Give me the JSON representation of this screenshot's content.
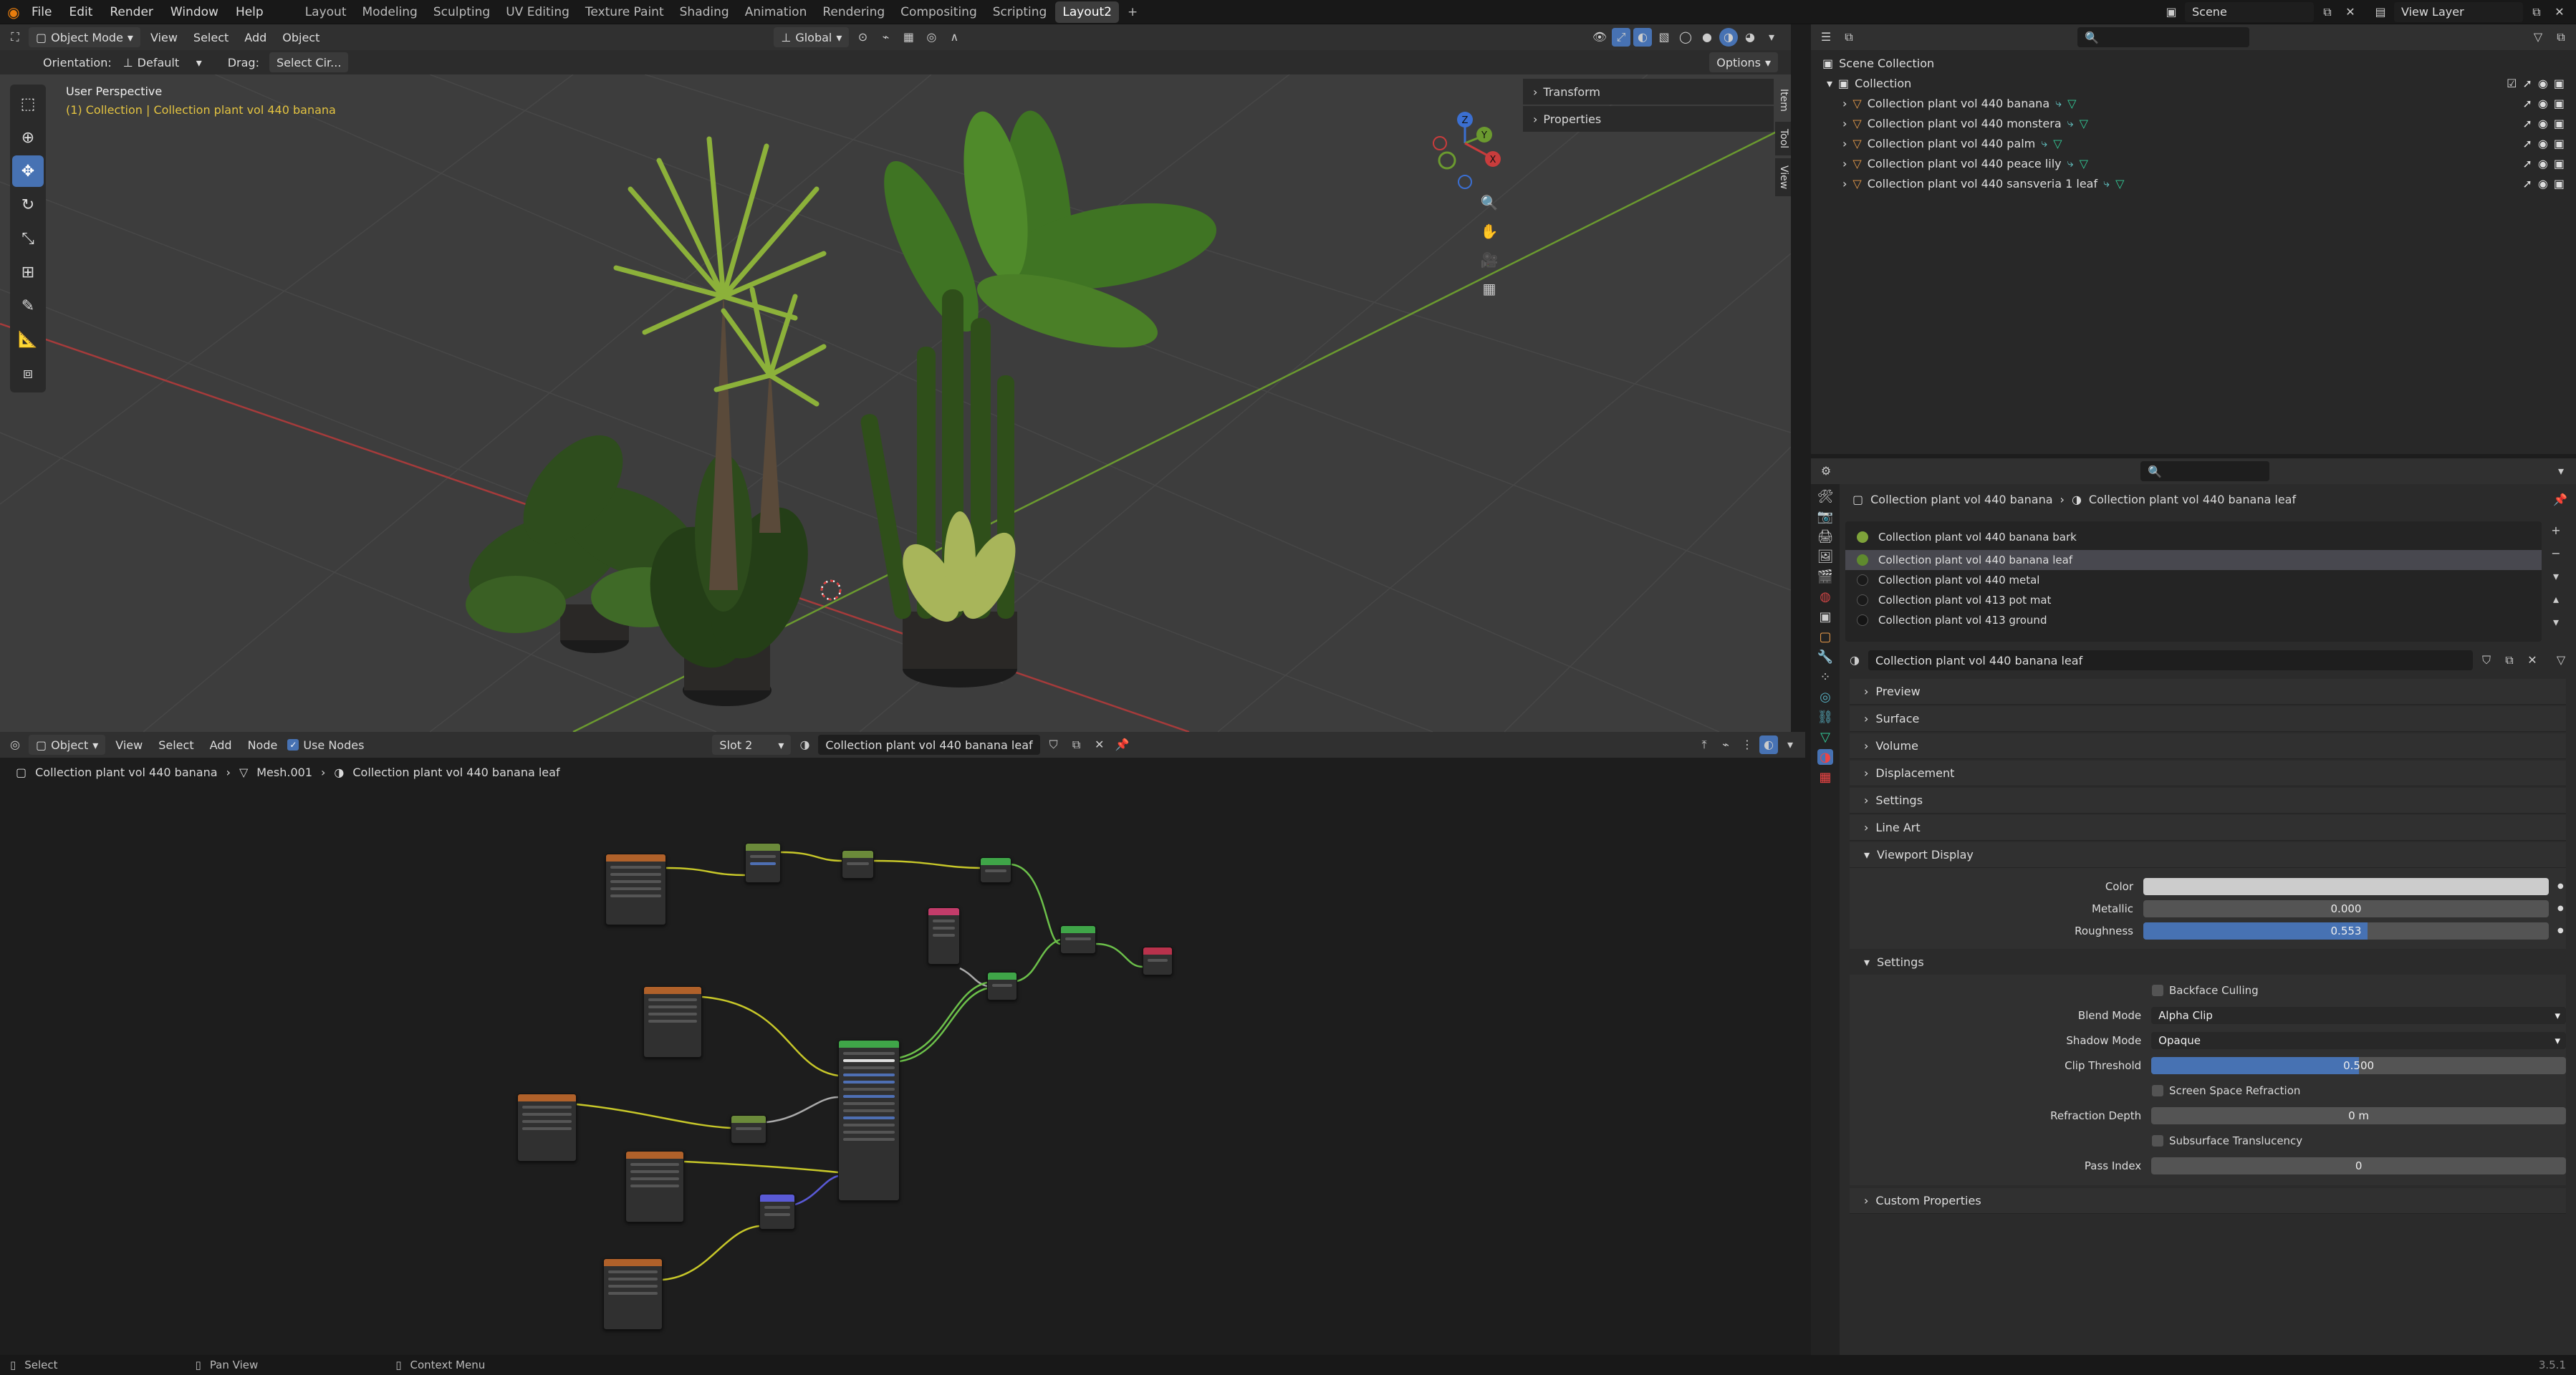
{
  "topbar": {
    "menus": [
      "File",
      "Edit",
      "Render",
      "Window",
      "Help"
    ],
    "workspaces": [
      "Layout",
      "Modeling",
      "Sculpting",
      "UV Editing",
      "Texture Paint",
      "Shading",
      "Animation",
      "Rendering",
      "Compositing",
      "Scripting",
      "Layout2"
    ],
    "active_workspace": "Layout2",
    "scene_label": "Scene",
    "view_layer_label": "View Layer"
  },
  "viewport": {
    "mode": "Object Mode",
    "menus": [
      "View",
      "Select",
      "Add",
      "Object"
    ],
    "transform_orientation": "Global",
    "orientation_label": "Orientation:",
    "orientation_value": "Default",
    "drag_label": "Drag:",
    "drag_value": "Select Cir...",
    "options_label": "Options",
    "perspective_label": "User Perspective",
    "context_label": "(1) Collection | Collection plant vol 440 banana",
    "sidebar_panels": [
      "Transform",
      "Properties"
    ],
    "side_tabs": [
      "Item",
      "Tool",
      "View"
    ],
    "gizmo_axes": {
      "x": "X",
      "y": "Y",
      "z": "Z"
    },
    "colors": {
      "bg": "#3d3d3d",
      "x_axis": "#a63b3b",
      "y_axis": "#6b9a2f",
      "context_text": "#e3c341"
    }
  },
  "node_editor": {
    "type_label": "Object",
    "menus": [
      "View",
      "Select",
      "Add",
      "Node"
    ],
    "use_nodes_label": "Use Nodes",
    "slot_label": "Slot 2",
    "material_name": "Collection plant vol 440 banana leaf",
    "breadcrumb": [
      "Collection plant vol 440 banana",
      "Mesh.001",
      "Collection plant vol 440 banana leaf"
    ]
  },
  "outliner": {
    "root": "Scene Collection",
    "collection": "Collection",
    "items": [
      "Collection plant vol 440 banana",
      "Collection plant vol 440 monstera",
      "Collection plant vol 440 palm",
      "Collection plant vol 440 peace lily",
      "Collection plant vol 440 sansveria 1 leaf"
    ]
  },
  "properties": {
    "breadcrumb_object": "Collection plant vol 440 banana",
    "breadcrumb_material": "Collection plant vol 440 banana leaf",
    "slots": [
      {
        "name": "Collection plant vol 440 banana bark",
        "color": "#7ea33a"
      },
      {
        "name": "Collection plant vol 440 banana leaf",
        "color": "#5f8a2e"
      },
      {
        "name": "Collection plant vol 440 metal",
        "color": "#1a1a1a"
      },
      {
        "name": "Collection plant vol 413 pot mat",
        "color": "#1a1a1a"
      },
      {
        "name": "Collection plant vol 413 ground",
        "color": "#151515"
      }
    ],
    "selected_slot": 1,
    "material_name": "Collection plant vol 440 banana leaf",
    "collapsed_panels": [
      "Preview",
      "Surface",
      "Volume",
      "Displacement",
      "Settings",
      "Line Art"
    ],
    "viewport_display": {
      "title": "Viewport Display",
      "color_label": "Color",
      "metallic_label": "Metallic",
      "metallic_value": "0.000",
      "roughness_label": "Roughness",
      "roughness_value": "0.553",
      "roughness_fraction": 0.553
    },
    "settings": {
      "title": "Settings",
      "backface_culling": "Backface Culling",
      "blend_mode_label": "Blend Mode",
      "blend_mode_value": "Alpha Clip",
      "shadow_mode_label": "Shadow Mode",
      "shadow_mode_value": "Opaque",
      "clip_threshold_label": "Clip Threshold",
      "clip_threshold_value": "0.500",
      "clip_threshold_fraction": 0.5,
      "screen_space_refraction": "Screen Space Refraction",
      "refraction_depth_label": "Refraction Depth",
      "refraction_depth_value": "0 m",
      "subsurface_translucency": "Subsurface Translucency",
      "pass_index_label": "Pass Index",
      "pass_index_value": "0"
    },
    "custom_properties": "Custom Properties"
  },
  "status": {
    "select": "Select",
    "pan": "Pan View",
    "context": "Context Menu",
    "version": "3.5.1"
  }
}
